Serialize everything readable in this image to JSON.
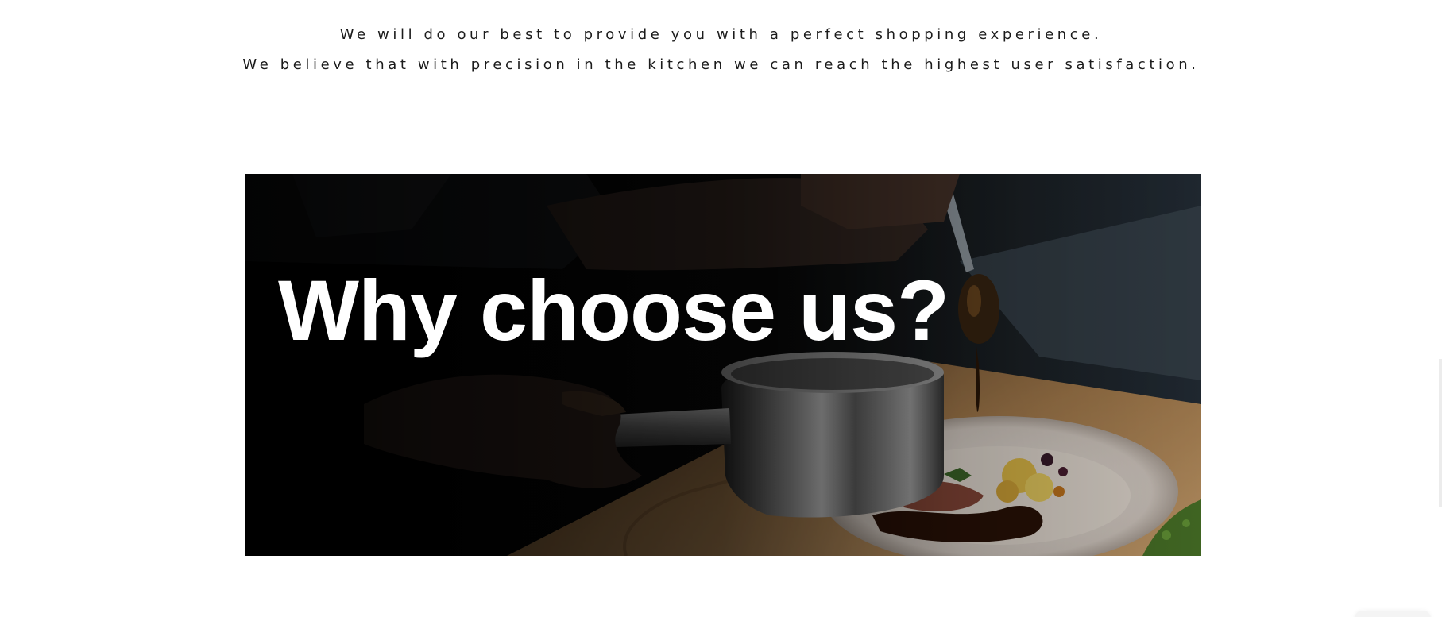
{
  "intro": {
    "line1": "We will do our best to provide you with a perfect shopping experience.",
    "line2": "We believe that with precision in the kitchen we can reach the highest user satisfaction."
  },
  "hero": {
    "title": "Why choose us?",
    "image": "chef-plating-dish-photo",
    "overlay_color": "#000000"
  },
  "colors": {
    "text": "#1b1b1b",
    "background": "#ffffff",
    "hero_title": "#ffffff"
  }
}
